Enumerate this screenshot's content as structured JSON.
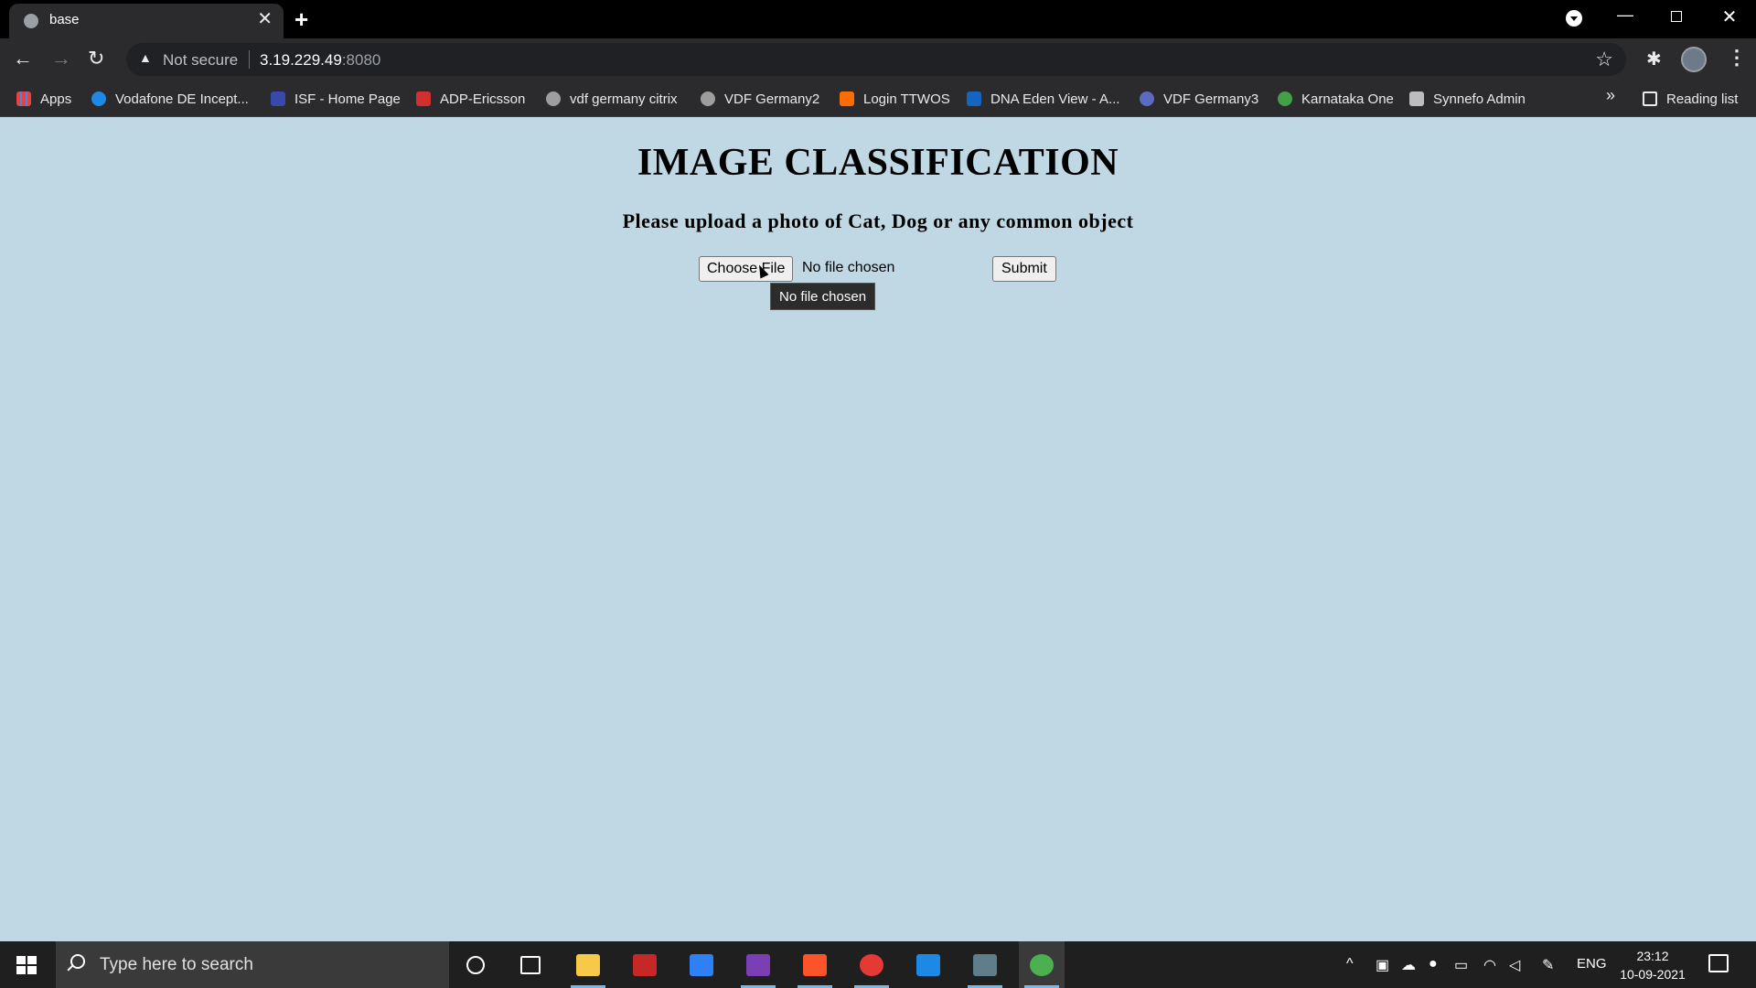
{
  "browser": {
    "tab_title": "base",
    "new_tab_label": "+",
    "close_tab_label": "✕",
    "address": {
      "security_label": "Not secure",
      "host": "3.19.229.49",
      "port": ":8080"
    },
    "bookmarks": [
      {
        "label": "Apps",
        "icon": "apps-grid-icon",
        "color": "#4285f4"
      },
      {
        "label": "Vodafone DE Incept...",
        "icon": "vodafone-icon",
        "color": "#1e88e5"
      },
      {
        "label": "ISF - Home Page",
        "icon": "isf-icon",
        "color": "#3949ab"
      },
      {
        "label": "ADP-Ericsson",
        "icon": "adp-icon",
        "color": "#d32f2f"
      },
      {
        "label": "vdf germany citrix",
        "icon": "citrix-icon",
        "color": "#9e9e9e"
      },
      {
        "label": "VDF Germany2",
        "icon": "citrix-icon",
        "color": "#9e9e9e"
      },
      {
        "label": "Login TTWOS",
        "icon": "ttwos-icon",
        "color": "#ff6d00"
      },
      {
        "label": "DNA Eden View - A...",
        "icon": "ac-icon",
        "color": "#1565c0"
      },
      {
        "label": "VDF Germany3",
        "icon": "lock-icon",
        "color": "#5c6bc0"
      },
      {
        "label": "Karnataka One",
        "icon": "karnataka-icon",
        "color": "#43a047"
      },
      {
        "label": "Synnefo Admin",
        "icon": "synnefo-icon",
        "color": "#bdbdbd"
      }
    ],
    "more_bookmarks": "»",
    "reading_list": "Reading list"
  },
  "page": {
    "title": "IMAGE CLASSIFICATION",
    "subtitle": "Please upload a photo of Cat, Dog or any common object",
    "choose_file_label": "Choose File",
    "file_status": "No file chosen",
    "submit_label": "Submit",
    "tooltip": "No file chosen",
    "background_color": "#c0d8e4"
  },
  "taskbar": {
    "search_placeholder": "Type here to search",
    "apps": [
      {
        "name": "file-explorer-icon",
        "color": "#f7c948",
        "active": false,
        "underline": true
      },
      {
        "name": "app-red-icon",
        "color": "#c62828",
        "active": false,
        "underline": false
      },
      {
        "name": "todo-icon",
        "color": "#2f7ff5",
        "active": false,
        "underline": false
      },
      {
        "name": "onenote-icon",
        "color": "#7b3fb5",
        "active": false,
        "underline": true
      },
      {
        "name": "brave-icon",
        "color": "#fb542b",
        "active": false,
        "underline": true
      },
      {
        "name": "app-record-icon",
        "color": "#e53935",
        "active": false,
        "underline": true
      },
      {
        "name": "photos-icon",
        "color": "#1e88e5",
        "active": false,
        "underline": false
      },
      {
        "name": "snip-icon",
        "color": "#607d8b",
        "active": false,
        "underline": true
      },
      {
        "name": "chrome-icon",
        "color": "#4caf50",
        "active": true,
        "underline": true
      }
    ],
    "language": "ENG",
    "time": "23:12",
    "date": "10-09-2021"
  }
}
